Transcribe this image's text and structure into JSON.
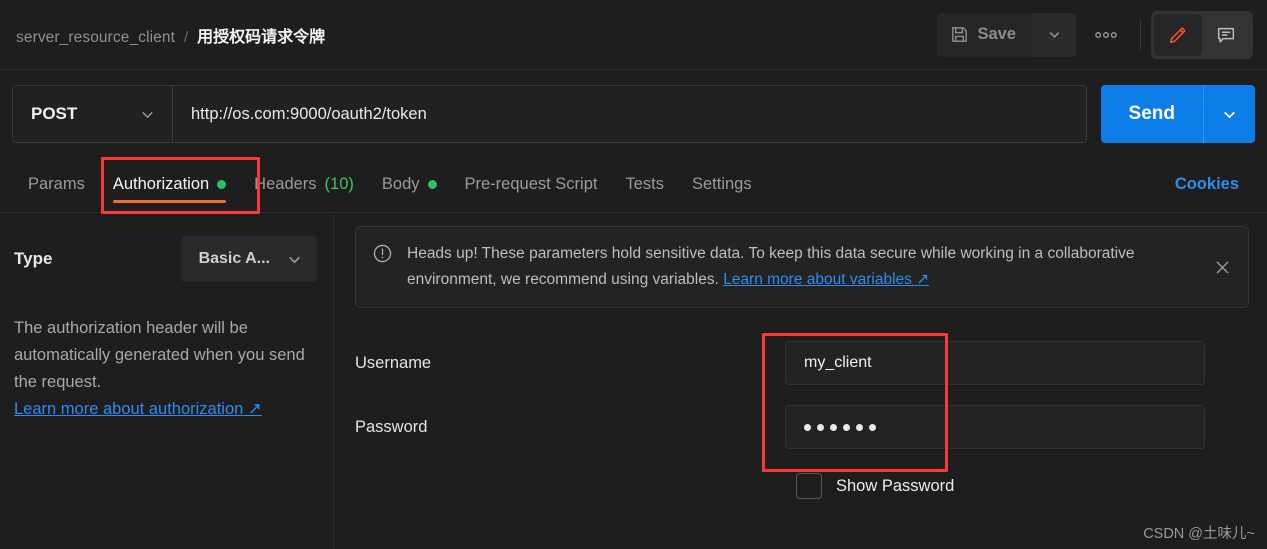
{
  "header": {
    "breadcrumb_collection": "server_resource_client",
    "breadcrumb_separator": "/",
    "breadcrumb_request": "用授权码请求令牌",
    "save_label": "Save",
    "save_icon": "floppy-disk-icon",
    "save_caret_icon": "chevron-down-icon",
    "more_icon": "three-dots-icon",
    "edit_icon": "pencil-icon",
    "comment_icon": "comment-icon",
    "accent_orange": "#f26c2a"
  },
  "request": {
    "method": "POST",
    "method_caret_icon": "chevron-down-icon",
    "url": "http://os.com:9000/oauth2/token",
    "send_label": "Send",
    "send_caret_icon": "chevron-down-icon",
    "send_color": "#0d7ee8"
  },
  "tabs": {
    "items": [
      {
        "label": "Params",
        "active": false,
        "dot": false,
        "count": ""
      },
      {
        "label": "Authorization",
        "active": true,
        "dot": true,
        "count": ""
      },
      {
        "label": "Headers",
        "active": false,
        "dot": false,
        "count": "(10)"
      },
      {
        "label": "Body",
        "active": false,
        "dot": true,
        "count": ""
      },
      {
        "label": "Pre-request Script",
        "active": false,
        "dot": false,
        "count": ""
      },
      {
        "label": "Tests",
        "active": false,
        "dot": false,
        "count": ""
      },
      {
        "label": "Settings",
        "active": false,
        "dot": false,
        "count": ""
      }
    ],
    "cookies_label": "Cookies",
    "dot_color": "#29c363",
    "count_color": "#3ec46d"
  },
  "auth_panel": {
    "type_label": "Type",
    "type_value": "Basic A...",
    "type_caret_icon": "chevron-down-icon",
    "description": "The authorization header will be automatically generated when you send the request.",
    "learn_more_label": "Learn more about authorization",
    "external_link_icon": "external-link-arrow-icon"
  },
  "banner": {
    "warning_icon": "exclamation-circle-icon",
    "text": "Heads up! These parameters hold sensitive data. To keep this data secure while working in a collaborative environment, we recommend using variables. ",
    "link_label": "Learn more about variables",
    "external_link_icon": "external-link-arrow-icon",
    "close_icon": "close-x-icon"
  },
  "credentials": {
    "username_label": "Username",
    "username_value": "my_client",
    "password_label": "Password",
    "password_masked": "••••••",
    "password_dot_count": 6,
    "show_password_label": "Show Password",
    "show_password_checked": false
  },
  "annotations": {
    "color": "#f8383c",
    "boxes": [
      "authorization-tab",
      "credential-inputs"
    ]
  },
  "watermark": "CSDN @土味儿~"
}
